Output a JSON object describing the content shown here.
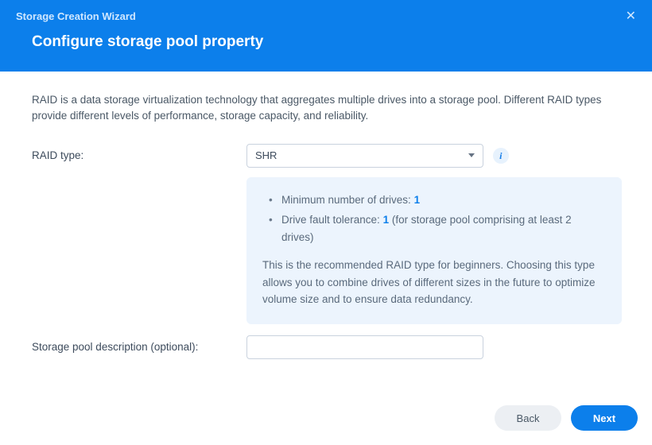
{
  "titlebar": {
    "title": "Storage Creation Wizard"
  },
  "page": {
    "heading": "Configure storage pool property"
  },
  "content": {
    "intro": "RAID is a data storage virtualization technology that aggregates multiple drives into a storage pool. Different RAID types provide different levels of performance, storage capacity, and reliability.",
    "raid_type_label": "RAID type:",
    "raid_type_value": "SHR",
    "info": {
      "min_drives_label": "Minimum number of drives: ",
      "min_drives_value": "1",
      "fault_label_pre": "Drive fault tolerance: ",
      "fault_value": "1",
      "fault_label_post": " (for storage pool comprising at least 2 drives)",
      "description": "This is the recommended RAID type for beginners. Choosing this type allows you to combine drives of different sizes in the future to optimize volume size and to ensure data redundancy."
    },
    "desc_label": "Storage pool description (optional):",
    "desc_value": ""
  },
  "footer": {
    "back": "Back",
    "next": "Next"
  }
}
